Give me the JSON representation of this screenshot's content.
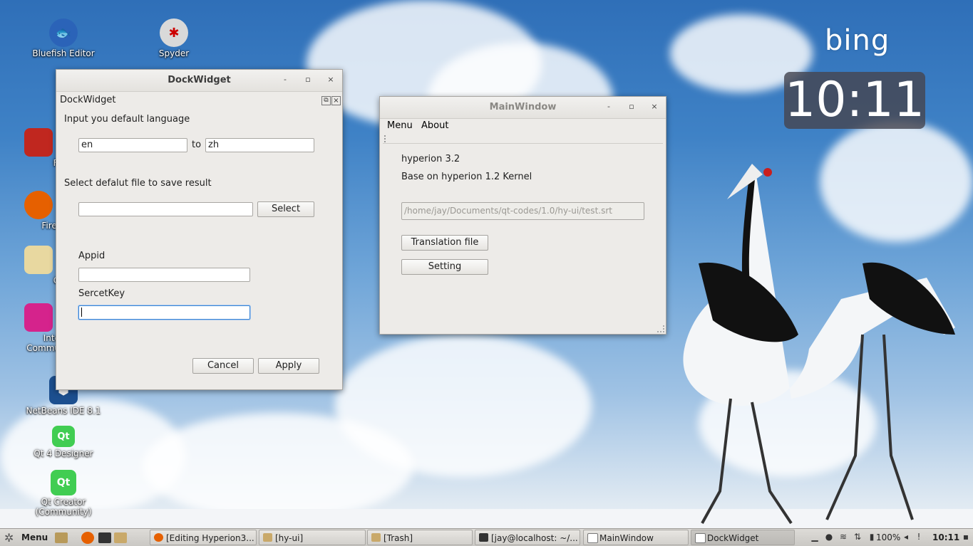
{
  "desktop": {
    "icons": [
      {
        "label": "Bluefish Editor",
        "icon": "bluefish-icon"
      },
      {
        "label": "Spyder",
        "icon": "spyder-icon"
      },
      {
        "label": "Fi",
        "icon": "file-icon"
      },
      {
        "label": "Firef",
        "icon": "firefox-icon"
      },
      {
        "label": "G",
        "icon": "gimp-icon"
      },
      {
        "label": "Inte",
        "icon": "intellij-icon"
      },
      {
        "label": "Commu",
        "icon": "intellij-community-label"
      },
      {
        "label": "NetBeans IDE 8.1",
        "icon": "netbeans-icon"
      },
      {
        "label": "Qt 4 Designer",
        "icon": "qt-designer-icon"
      },
      {
        "label": "Qt Creator",
        "icon": "qt-creator-icon"
      },
      {
        "label": "(Community)",
        "icon": "qt-creator-community-label"
      }
    ],
    "bing_logo": "bing",
    "clock": "10:11"
  },
  "dock_widget_window": {
    "title": "DockWidget",
    "buttons": {
      "minimize": "-",
      "maximize": "▫",
      "close": "×"
    },
    "dock_title": "DockWidget",
    "dock_float": "⧉",
    "dock_close": "×",
    "lang_label": "Input you default language",
    "from_value": "en",
    "to_label": "to",
    "to_value": "zh",
    "file_label": "Select defalut file to save result",
    "file_value": "",
    "select_button": "Select",
    "appid_label": "Appid",
    "appid_value": "",
    "secret_label": "SercetKey",
    "secret_value": "",
    "cancel_button": "Cancel",
    "apply_button": "Apply"
  },
  "main_window": {
    "title": "MainWindow",
    "buttons": {
      "minimize": "-",
      "maximize": "▫",
      "close": "×"
    },
    "menu": [
      "Menu",
      "About"
    ],
    "version": "hyperion 3.2",
    "kernel": "Base on hyperion 1.2 Kernel",
    "path_placeholder": "/home/jay/Documents/qt-codes/1.0/hy-ui/test.srt",
    "translation_button": "Translation file",
    "setting_button": "Setting"
  },
  "taskbar": {
    "menu_label": "Menu",
    "tasks": [
      {
        "label": "[Editing Hyperion3...",
        "icon": "firefox-icon"
      },
      {
        "label": "[hy-ui]",
        "icon": "folder-icon"
      },
      {
        "label": "[Trash]",
        "icon": "folder-icon"
      },
      {
        "label": "[jay@localhost: ~/...",
        "icon": "terminal-icon"
      },
      {
        "label": "MainWindow",
        "icon": "window-icon"
      },
      {
        "label": "DockWidget",
        "icon": "window-icon"
      }
    ],
    "battery": "100%",
    "time": "10:11"
  }
}
